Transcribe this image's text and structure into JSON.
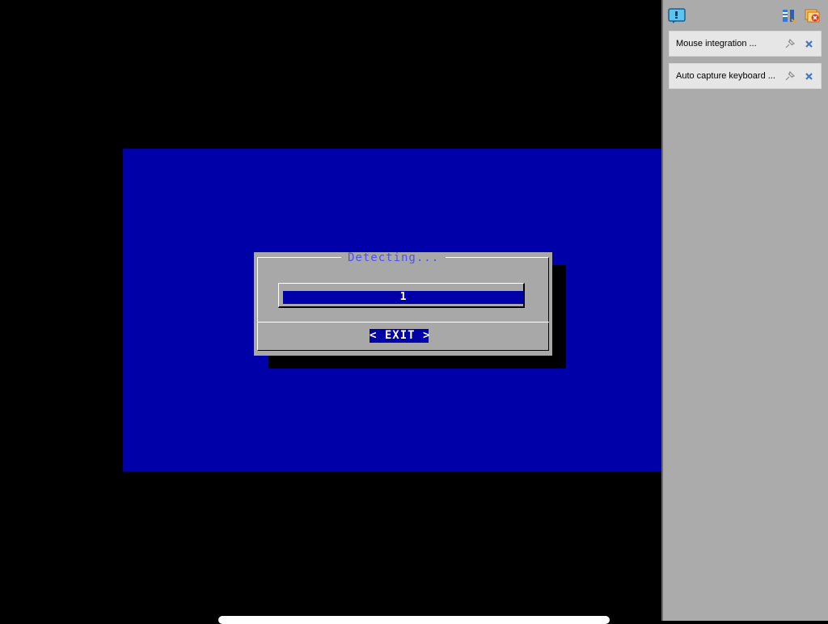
{
  "dialog": {
    "title": "Detecting...",
    "gauge_value": "1",
    "exit_label": "< EXIT >"
  },
  "notification_panel": {
    "top_icons": [
      "message-icon",
      "columns-settings-icon",
      "close-all-icon"
    ],
    "notifications": [
      {
        "label": "Mouse integration ...",
        "icons": [
          "pin-icon",
          "close-icon"
        ]
      },
      {
        "label": "Auto capture keyboard ...",
        "icons": [
          "pin-icon",
          "close-icon"
        ]
      }
    ]
  },
  "colors": {
    "console_blue": "#0000a8",
    "dialog_gray": "#a8a8a8",
    "title_blue": "#5050f0",
    "panel_gray": "#ababab"
  }
}
